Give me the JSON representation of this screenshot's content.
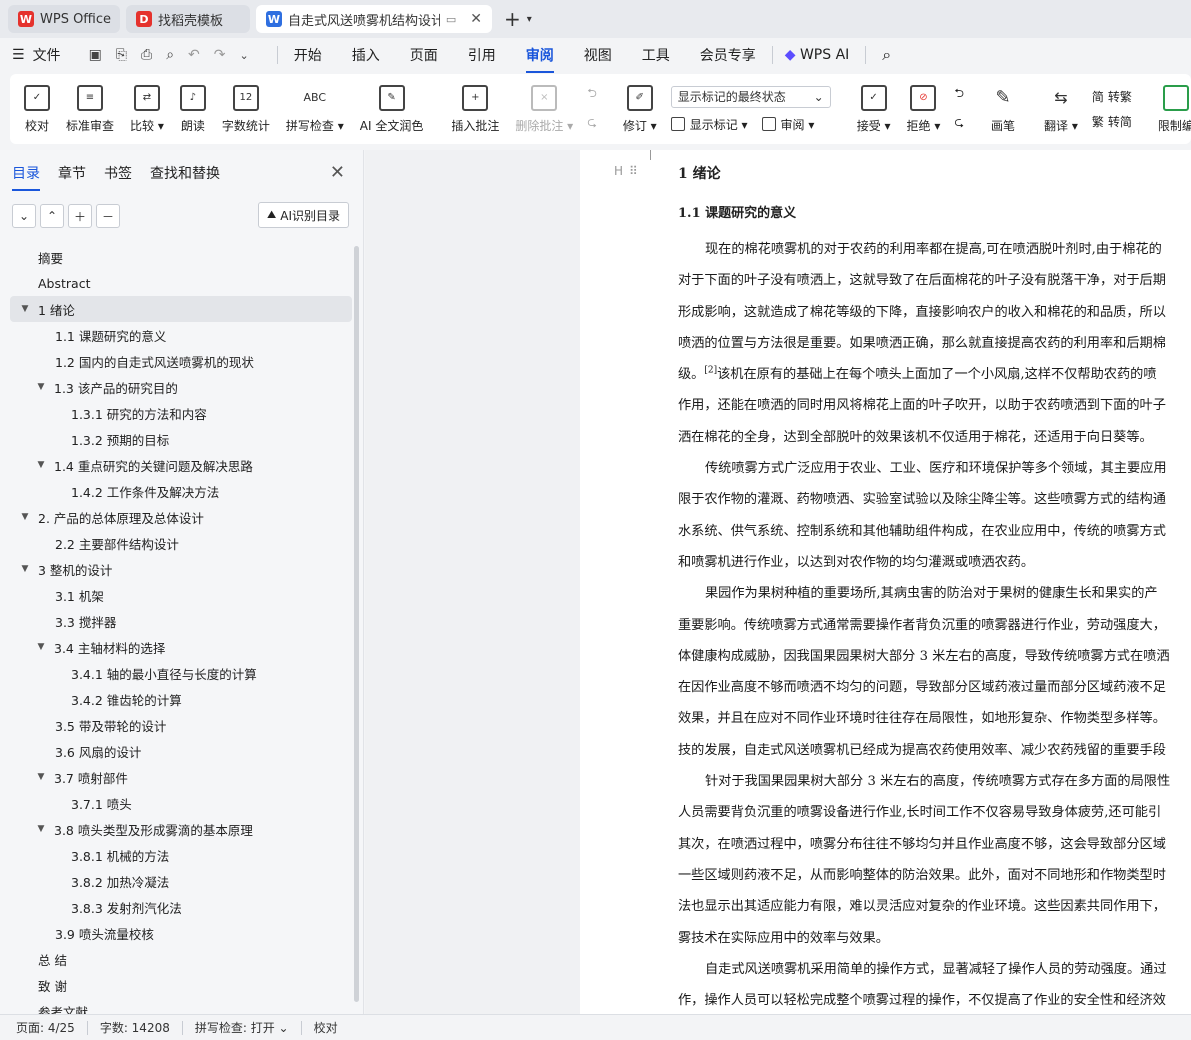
{
  "tabs": [
    {
      "label": "WPS Office",
      "logo": "W",
      "logo_color": "#e5322d"
    },
    {
      "label": "找稻壳模板",
      "logo": "D",
      "logo_color": "#e5322d"
    },
    {
      "label": "自走式风送喷雾机结构设计 论",
      "logo": "W",
      "logo_color": "#2f6fe0"
    }
  ],
  "menu": {
    "file": "文件",
    "items": [
      "开始",
      "插入",
      "页面",
      "引用",
      "审阅",
      "视图",
      "工具",
      "会员专享",
      "WPS AI"
    ],
    "active": "审阅"
  },
  "ribbon": {
    "proof": "校对",
    "std_review": "标准审查",
    "compare": "比较",
    "read_aloud": "朗读",
    "word_count": "字数统计",
    "word_count_icon": "12",
    "spell_check": "拼写检查",
    "spell_icon": "ABC",
    "ai_polish": "AI 全文润色",
    "insert_comment": "插入批注",
    "delete_comment": "删除批注",
    "markup_select": "显示标记的最终状态",
    "track": "修订",
    "show_markup": "显示标记",
    "review": "审阅",
    "accept": "接受",
    "reject": "拒绝",
    "pen": "画笔",
    "translate": "翻译",
    "to_trad": "转繁",
    "to_trad_icon": "简",
    "to_simp": "转简",
    "to_simp_icon": "繁",
    "restrict": "限制编"
  },
  "nav": {
    "tabs": [
      "目录",
      "章节",
      "书签",
      "查找和替换"
    ],
    "ai_toc": "AI识别目录",
    "toc": [
      {
        "label": "摘要",
        "level": 0
      },
      {
        "label": "Abstract",
        "level": 0
      },
      {
        "label": "1  绪论",
        "level": 1,
        "expanded": true,
        "active": true
      },
      {
        "label": "1.1 课题研究的意义",
        "level": 2
      },
      {
        "label": "1.2 国内的自走式风送喷雾机的现状",
        "level": 2
      },
      {
        "label": "1.3  该产品的研究目的",
        "level": 2,
        "expanded": true
      },
      {
        "label": "1.3.1  研究的方法和内容",
        "level": 3
      },
      {
        "label": "1.3.2 预期的目标",
        "level": 3
      },
      {
        "label": "1.4 重点研究的关键问题及解决思路",
        "level": 2,
        "expanded": true
      },
      {
        "label": "1.4.2 工作条件及解决方法",
        "level": 3
      },
      {
        "label": "2.  产品的总体原理及总体设计",
        "level": 1,
        "expanded": true
      },
      {
        "label": "2.2  主要部件结构设计",
        "level": 2
      },
      {
        "label": "3  整机的设计",
        "level": 1,
        "expanded": true
      },
      {
        "label": "3.1  机架",
        "level": 2
      },
      {
        "label": "3.3  搅拌器",
        "level": 2
      },
      {
        "label": "3.4  主轴材料的选择",
        "level": 2,
        "expanded": true
      },
      {
        "label": "3.4.1  轴的最小直径与长度的计算",
        "level": 3
      },
      {
        "label": "3.4.2  锥齿轮的计算",
        "level": 3
      },
      {
        "label": "3.5  带及带轮的设计",
        "level": 2
      },
      {
        "label": "3.6  风扇的设计",
        "level": 2
      },
      {
        "label": "3.7 喷射部件",
        "level": 2,
        "expanded": true
      },
      {
        "label": "3.7.1  喷头",
        "level": 3
      },
      {
        "label": "3.8 喷头类型及形成雾滴的基本原理",
        "level": 2,
        "expanded": true
      },
      {
        "label": "3.8.1  机械的方法",
        "level": 3
      },
      {
        "label": "3.8.2  加热冷凝法",
        "level": 3
      },
      {
        "label": "3.8.3  发射剂汽化法",
        "level": 3
      },
      {
        "label": "3.9  喷头流量校核",
        "level": 2
      },
      {
        "label": "总  结",
        "level": 0
      },
      {
        "label": "致  谢",
        "level": 0
      },
      {
        "label": "参考文献",
        "level": 0
      }
    ]
  },
  "doc": {
    "h1": "1  绪论",
    "h2": "1.1  课题研究的意义",
    "lines": [
      {
        "text": "现在的棉花喷雾机的对于农药的利用率都在提高,可在喷洒脱叶剂时,由于棉花的",
        "indent": true
      },
      {
        "text": "对于下面的叶子没有喷洒上，这就导致了在后面棉花的叶子没有脱落干净，对于后期",
        "indent": false
      },
      {
        "text": "形成影响，这就造成了棉花等级的下降，直接影响农户的收入和棉花的和品质，所以",
        "indent": false
      },
      {
        "text": "喷洒的位置与方法很是重要。如果喷洒正确，那么就直接提高农药的利用率和后期棉",
        "indent": false
      },
      {
        "text": "级。",
        "sup": "[2]",
        "after": "该机在原有的基础上在每个喷头上面加了一个小风扇,这样不仅帮助农药的喷",
        "indent": false
      },
      {
        "text": "作用，还能在喷洒的同时用风将棉花上面的叶子吹开，以助于农药喷洒到下面的叶子",
        "indent": false
      },
      {
        "text": "洒在棉花的全身，达到全部脱叶的效果该机不仅适用于棉花，还适用于向日葵等。",
        "indent": false
      },
      {
        "text": "传统喷雾方式广泛应用于农业、工业、医疗和环境保护等多个领域，其主要应用",
        "indent": true
      },
      {
        "text": "限于农作物的灌溉、药物喷洒、实验室试验以及除尘降尘等。这些喷雾方式的结构通",
        "indent": false
      },
      {
        "text": "水系统、供气系统、控制系统和其他辅助组件构成，在农业应用中，传统的喷雾方式",
        "indent": false
      },
      {
        "text": "和喷雾机进行作业，以达到对农作物的均匀灌溉或喷洒农药。",
        "indent": false
      },
      {
        "text": "果园作为果树种植的重要场所,其病虫害的防治对于果树的健康生长和果实的产",
        "indent": true
      },
      {
        "text": "重要影响。传统喷雾方式通常需要操作者背负沉重的喷雾器进行作业，劳动强度大，",
        "indent": false
      },
      {
        "text": "体健康构成威胁，因我国果园果树大部分 3 米左右的高度，导致传统喷雾方式在喷洒",
        "indent": false
      },
      {
        "text": "在因作业高度不够而喷洒不均匀的问题，导致部分区域药液过量而部分区域药液不足",
        "indent": false
      },
      {
        "text": "效果，并且在应对不同作业环境时往往存在局限性，如地形复杂、作物类型多样等。",
        "indent": false
      },
      {
        "text": "技的发展，自走式风送喷雾机已经成为提高农药使用效率、减少农药残留的重要手段",
        "indent": false
      },
      {
        "text": "针对于我国果园果树大部分 3 米左右的高度，传统喷雾方式存在多方面的局限性",
        "indent": true
      },
      {
        "text": "人员需要背负沉重的喷雾设备进行作业,长时间工作不仅容易导致身体疲劳,还可能引",
        "indent": false
      },
      {
        "text": "其次，在喷洒过程中，喷雾分布往往不够均匀并且作业高度不够，这会导致部分区域",
        "indent": false
      },
      {
        "text": "一些区域则药液不足，从而影响整体的防治效果。此外，面对不同地形和作物类型时",
        "indent": false
      },
      {
        "text": "法也显示出其适应能力有限，难以灵活应对复杂的作业环境。这些因素共同作用下，",
        "indent": false
      },
      {
        "text": "雾技术在实际应用中的效率与效果。",
        "indent": false
      },
      {
        "text": "自走式风送喷雾机采用简单的操作方式，显著减轻了操作人员的劳动强度。通过",
        "indent": true
      },
      {
        "text": "作，操作人员可以轻松完成整个喷雾过程的操作，不仅提高了作业的安全性和经济效",
        "indent": false
      }
    ]
  },
  "status": {
    "page": "页面: 4/25",
    "words": "字数: 14208",
    "spell": "拼写检查: 打开",
    "proof": "校对"
  },
  "colors": {
    "accent": "#1a56db"
  }
}
